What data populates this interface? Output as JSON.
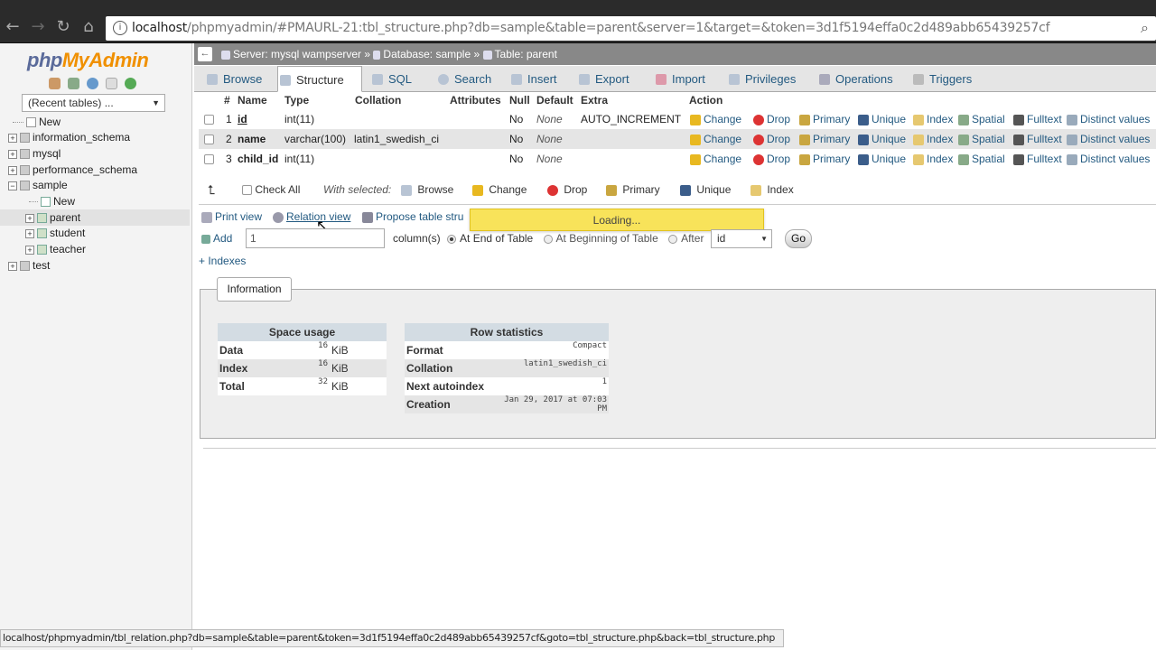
{
  "browser": {
    "url_host": "localhost",
    "url_rest": "/phpmyadmin/#PMAURL-21:tbl_structure.php?db=sample&table=parent&server=1&target=&token=3d1f5194effa0c2d489abb65439257cf",
    "back_icon": "arrow-left-icon",
    "status_url": "localhost/phpmyadmin/tbl_relation.php?db=sample&table=parent&token=3d1f5194effa0c2d489abb65439257cf&goto=tbl_structure.php&back=tbl_structure.php"
  },
  "sidebar": {
    "logo_php": "php",
    "logo_rest": "MyAdmin",
    "recent": "(Recent tables) ...",
    "tree": [
      {
        "label": "New",
        "type": "new"
      },
      {
        "label": "information_schema",
        "type": "db"
      },
      {
        "label": "mysql",
        "type": "db"
      },
      {
        "label": "performance_schema",
        "type": "db"
      },
      {
        "label": "sample",
        "type": "db-open"
      },
      {
        "label": "New",
        "type": "new-sub"
      },
      {
        "label": "parent",
        "type": "table",
        "selected": true
      },
      {
        "label": "student",
        "type": "table"
      },
      {
        "label": "teacher",
        "type": "table"
      },
      {
        "label": "test",
        "type": "db"
      }
    ]
  },
  "breadcrumb": {
    "server": "Server: mysql wampserver",
    "database": "Database: sample",
    "table": "Table: parent",
    "sep": "»"
  },
  "tabs": [
    "Browse",
    "Structure",
    "SQL",
    "Search",
    "Insert",
    "Export",
    "Import",
    "Privileges",
    "Operations",
    "Triggers"
  ],
  "active_tab": "Structure",
  "table": {
    "headers": [
      "#",
      "Name",
      "Type",
      "Collation",
      "Attributes",
      "Null",
      "Default",
      "Extra",
      "Action"
    ],
    "rows": [
      {
        "num": "1",
        "name": "id",
        "type": "int(11)",
        "collation": "",
        "null": "No",
        "default": "None",
        "extra": "AUTO_INCREMENT"
      },
      {
        "num": "2",
        "name": "name",
        "type": "varchar(100)",
        "collation": "latin1_swedish_ci",
        "null": "No",
        "default": "None",
        "extra": ""
      },
      {
        "num": "3",
        "name": "child_id",
        "type": "int(11)",
        "collation": "",
        "null": "No",
        "default": "None",
        "extra": ""
      }
    ],
    "actions": [
      "Change",
      "Drop",
      "Primary",
      "Unique",
      "Index",
      "Spatial",
      "Fulltext",
      "Distinct values"
    ]
  },
  "with_selected": {
    "check_all": "Check All",
    "label": "With selected:",
    "actions": [
      "Browse",
      "Change",
      "Drop",
      "Primary",
      "Unique",
      "Index"
    ]
  },
  "tools": {
    "print_view": "Print view",
    "relation_view": "Relation view",
    "propose": "Propose table stru",
    "loading": "Loading..."
  },
  "add_columns": {
    "add_label": "Add",
    "count": "1",
    "columns_label": "column(s)",
    "at_end": "At End of Table",
    "at_beginning": "At Beginning of Table",
    "after": "After",
    "after_value": "id",
    "go": "Go",
    "indexes": "+ Indexes"
  },
  "information": {
    "legend": "Information",
    "space_usage": {
      "title": "Space usage",
      "rows": [
        {
          "name": "Data",
          "value": "16",
          "unit": "KiB"
        },
        {
          "name": "Index",
          "value": "16",
          "unit": "KiB"
        },
        {
          "name": "Total",
          "value": "32",
          "unit": "KiB"
        }
      ]
    },
    "row_statistics": {
      "title": "Row statistics",
      "rows": [
        {
          "name": "Format",
          "value": "Compact"
        },
        {
          "name": "Collation",
          "value": "latin1_swedish_ci"
        },
        {
          "name": "Next autoindex",
          "value": "1"
        },
        {
          "name": "Creation",
          "value": "Jan 29, 2017 at 07:03 PM"
        }
      ]
    }
  }
}
